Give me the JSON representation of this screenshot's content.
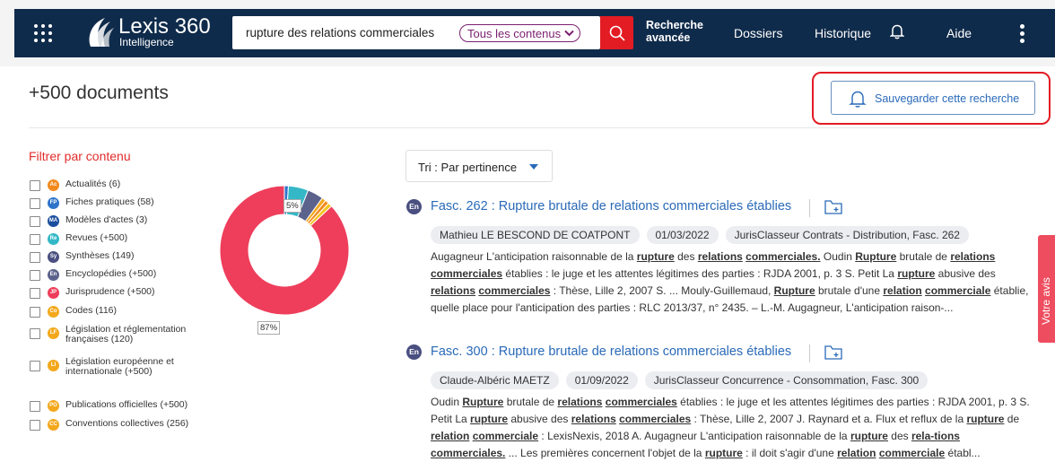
{
  "header": {
    "logo_name": "Lexis 360",
    "logo_subtitle": "Intelligence",
    "search_query": "rupture des relations commerciales",
    "scope_label": "Tous les contenus",
    "advanced_search": "Recherche avancée",
    "nav": {
      "dossiers": "Dossiers",
      "historique": "Historique",
      "aide": "Aide"
    },
    "icons": [
      "apps-grid-icon",
      "search-icon",
      "bell-icon",
      "more-vertical-icon"
    ],
    "colors": {
      "navbar": "#0f2b4b",
      "search_button": "#e31b23",
      "scope_pill": "#7a1f6f"
    }
  },
  "results": {
    "count_label": "+500 documents",
    "save_search": "Sauvegarder cette recherche",
    "sort_label": "Tri : Par pertinence"
  },
  "filters": {
    "title": "Filtrer par contenu",
    "items": [
      {
        "badge": "Ac",
        "label": "Actualités (6)",
        "color": "#f38a1e"
      },
      {
        "badge": "FP",
        "label": "Fiches pratiques (58)",
        "color": "#2e74c9"
      },
      {
        "badge": "MA",
        "label": "Modèles d'actes (3)",
        "color": "#1c4e9e"
      },
      {
        "badge": "Re",
        "label": "Revues (+500)",
        "color": "#34b8c7"
      },
      {
        "badge": "Sy",
        "label": "Synthèses (149)",
        "color": "#4a4f80"
      },
      {
        "badge": "En",
        "label": "Encyclopédies (+500)",
        "color": "#5b628c"
      },
      {
        "badge": "JP",
        "label": "Jurisprudence (+500)",
        "color": "#ee3e5b"
      },
      {
        "badge": "Co",
        "label": "Codes (116)",
        "color": "#f3a81c"
      },
      {
        "badge": "LF",
        "label": "Législation et réglementation",
        "label2": "françaises (120)",
        "color": "#f3a81c"
      },
      {
        "badge": "LI",
        "label": "Législation européenne et",
        "label2": "internationale (+500)",
        "color": "#f3a81c"
      },
      {
        "badge": "PO",
        "label": "Publications officielles (+500)",
        "color": "#f3a81c"
      },
      {
        "badge": "CC",
        "label": "Conventions collectives (256)",
        "color": "#f3a81c"
      }
    ]
  },
  "chart_data": {
    "type": "pie",
    "labels": [
      "87%",
      "5%"
    ],
    "segments": [
      {
        "category": "Jurisprudence",
        "value": 87,
        "color": "#ee3e5b"
      },
      {
        "category": "Fiches pratiques",
        "value": 1,
        "color": "#2e74c9"
      },
      {
        "category": "Revues",
        "value": 5,
        "color": "#34b8c7"
      },
      {
        "category": "Encyclopédies",
        "value": 4,
        "color": "#5b628c"
      },
      {
        "category": "Codes",
        "value": 1,
        "color": "#f3a81c"
      },
      {
        "category": "Actualités",
        "value": 1,
        "color": "#f38a1e"
      },
      {
        "category": "Législation",
        "value": 1,
        "color": "#f3c41c"
      }
    ]
  },
  "documents": [
    {
      "type_badge": "En",
      "title": "Fasc. 262 : Rupture brutale de relations commerciales établies",
      "tags": [
        "Mathieu LE BESCOND DE COATPONT",
        "01/03/2022",
        "JurisClasseur Contrats - Distribution, Fasc. 262"
      ],
      "snippet": "Augagneur L'anticipation raisonnable de la <b><u>rupture</u></b> des <b><u>relations</u></b> <b><u>commerciales.</u></b> Oudin <b><u>Rupture</u></b> brutale de <b><u>relations</u></b> <b><u>commerciales</u></b> établies : le juge et les attentes légitimes des parties : RJDA 2001, p. 3 S. Petit La <b><u>rupture</u></b> abusive des <b><u>relations</u></b> <b><u>commerciales</u></b> : Thèse, Lille 2, 2007 S. ... Mouly-Guillemaud, <b><u>Rupture</u></b> brutale d'une <b><u>relation</u></b> <b><u>commerciale</u></b> établie, quelle place pour l'anticipation des parties : RLC 2013/37, n° 2435. – L.-M. Augagneur, L'anticipation raison-..."
    },
    {
      "type_badge": "En",
      "title": "Fasc. 300 : Rupture brutale de relations commerciales établies",
      "tags": [
        "Claude-Albéric MAETZ",
        "01/09/2022",
        "JurisClasseur Concurrence - Consommation, Fasc. 300"
      ],
      "snippet": "Oudin <b><u>Rupture</u></b> brutale de <b><u>relations</u></b> <b><u>commerciales</u></b> établies : le juge et les attentes légitimes des parties : RJDA 2001, p. 3 S. Petit La <b><u>rupture</u></b> abusive des <b><u>relations</u></b> <b><u>commerciales</u></b> : Thèse, Lille 2, 2007 J. Raynard et a. Flux et reflux de la <b><u>rupture</u></b> de <b><u>relation</u></b> <b><u>commerciale</u></b> : LexisNexis, 2018 A. Augagneur L'anticipation raisonnable de la <b><u>rupture</u></b> des <b><u>rela-tions</u></b> <b><u>commerciales.</u></b> ... Les premières concernent l'objet de la <b><u>rupture</u></b> : il doit s'agir d'une <b><u>relation</u></b> <b><u>commerciale</u></b> établ..."
    }
  ],
  "feedback_tab": "Votre avis"
}
